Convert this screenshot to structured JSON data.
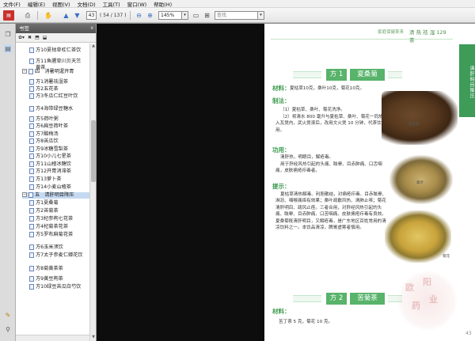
{
  "menu": [
    "文件(F)",
    "编辑(E)",
    "视图(V)",
    "文档(D)",
    "工具(T)",
    "窗口(W)",
    "帮助(H)"
  ],
  "toolbar": {
    "page_current": "43",
    "page_total": "( 54 / 137 )",
    "zoom": "145%",
    "search_placeholder": "查找"
  },
  "bookmarks": {
    "title": "书签",
    "close": "x",
    "options_label": "✿▾",
    "items": [
      {
        "label": "方10夏枯草杠仁茶饮",
        "level": 2
      },
      {
        "label": "方11鱼腥草川贝天竺黄茶",
        "level": 2
      },
      {
        "label": "四　消暑明渥开胃",
        "level": 1,
        "expanded": true
      },
      {
        "label": "方1消暑祛湿茶",
        "level": 2
      },
      {
        "label": "方2五花茶",
        "level": 2
      },
      {
        "label": "方3冬瓜仁红豆叶饮",
        "level": 2
      },
      {
        "label": "方4海带绿豆糖水",
        "level": 2
      },
      {
        "label": "方5荷叶粥",
        "level": 2
      },
      {
        "label": "方6扁豆荷叶茶",
        "level": 2
      },
      {
        "label": "方7酸梅汤",
        "level": 2
      },
      {
        "label": "方8苦瓜饮",
        "level": 2
      },
      {
        "label": "方9冰糖雪梨茶",
        "level": 2
      },
      {
        "label": "方10小儿七星茶",
        "level": 2
      },
      {
        "label": "方11山楂冰糖饮",
        "level": 2
      },
      {
        "label": "方12开胃消滞茶",
        "level": 2
      },
      {
        "label": "方13萝卜茶",
        "level": 2
      },
      {
        "label": "方14小麦山楂茶",
        "level": 2
      },
      {
        "label": "五　清肝明目降压",
        "level": 1,
        "expanded": true,
        "selected": true
      },
      {
        "label": "方1夏桑菊",
        "level": 2
      },
      {
        "label": "方2苦菊茶",
        "level": 2
      },
      {
        "label": "方3杞参枸七花茶",
        "level": 2
      },
      {
        "label": "方4杞菊茶花茶",
        "level": 2
      },
      {
        "label": "方5罗布麻菊花茶",
        "level": 2
      },
      {
        "label": "方6玉米须饮",
        "level": 2
      },
      {
        "label": "方7太子参麦仁蝉花饮",
        "level": 2
      },
      {
        "label": "方8菊黄茶茶",
        "level": 2
      },
      {
        "label": "方9黄豆枸茶",
        "level": 2
      },
      {
        "label": "方10绿豆苦瓜白芍饮",
        "level": 2
      }
    ]
  },
  "page": {
    "header_text": "家庭保健茶来",
    "header_text_right": "清 热 祛 湿 129 茶",
    "side_tab": "清肝明目降压",
    "recipe1": {
      "num": "方 1",
      "name": "夏桑菊"
    },
    "sections": {
      "materials_h": "材料：",
      "materials_t": "夏枯草10克，桑叶10克，菊花10克。",
      "method_h": "制法：",
      "method_t1": "（1）夏枯草、桑叶、菊花洗净。",
      "method_t2": "（2）将清水 800 毫升与夏枯草、桑叶、菊花一同放入瓦煲内，武火煲滚后，改用文火煲 10 分钟，代茶饮用。",
      "effect_h": "功用：",
      "effect_t1": "清肝热，明眼目，解疮毒。",
      "effect_t2": "用于肝经风热引起的头痛、眩晕、目赤肿痛、口舌咽痛，皮肤痈疮疖毒者。",
      "note_h": "提示：",
      "note_t": "夏枯草清热解毒、利胆散结，对痈疮疖毒、目赤眩晕、淋沥、咽喉痛痒有效果；桑叶疏散风热、清肺止咳；菊花清肝明目、疏风止痉。三者合用，对肝经风热引起的头痛、眩晕、目赤肿痛、口苦咽痛、皮肤痈疮疖毒有良效。夏桑菊既清肝明目，又解疮毒，是广东地区百姓常用的清凉饮料之一。本饮品清凉，脾胃虚寒者慎用。"
    },
    "captions": {
      "c1": "夏枯草",
      "c2": "桑叶",
      "c3": "菊花"
    },
    "recipe2": {
      "num": "方 2",
      "name": "苦菊茶"
    },
    "materials2_h": "材料：",
    "materials2_t": "苦丁茶 5 克，菊花 10 克。",
    "page_number": "43",
    "watermark_glyphs": [
      "欧",
      "阳",
      "药",
      "业"
    ]
  },
  "colors": {
    "accent_green": "#58b36b",
    "heading_green": "#3c9a4f",
    "side_tab_green": "#3e9b58"
  }
}
